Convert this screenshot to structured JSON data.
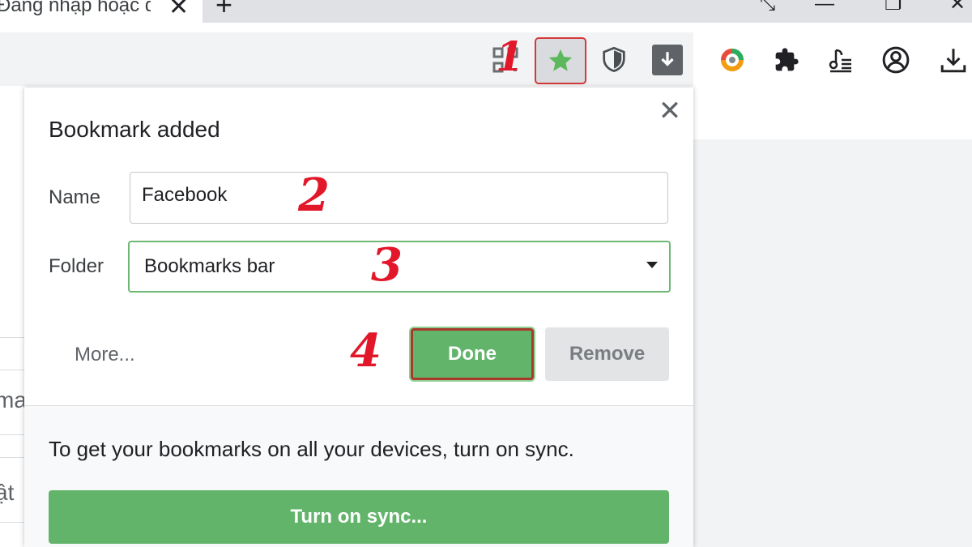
{
  "tab": {
    "title": "Đăng nhập hoặc đ",
    "close_glyph": "✕",
    "new_tab_glyph": "+"
  },
  "window": {
    "controls": [
      "⤡",
      "—",
      "❐",
      "✕"
    ]
  },
  "toolbar": {
    "icons": [
      "qr-code-icon",
      "star-icon",
      "shield-icon",
      "download-arrow-icon",
      "colorful-ring-icon",
      "puzzle-icon",
      "media-music-icon",
      "profile-icon",
      "download-icon"
    ],
    "star_color": "#5cb85c"
  },
  "annotations": {
    "n1": "1",
    "n2": "2",
    "n3": "3",
    "n4": "4",
    "color": "#e2182a"
  },
  "left_fragments": [
    "ma",
    "ật"
  ],
  "dialog": {
    "title": "Bookmark added",
    "close_glyph": "✕",
    "name_label": "Name",
    "name_value": "Facebook",
    "folder_label": "Folder",
    "folder_value": "Bookmarks bar",
    "more_label": "More...",
    "done_label": "Done",
    "remove_label": "Remove",
    "sync_message": "To get your bookmarks on all your devices, turn on sync.",
    "sync_button_label": "Turn on sync...",
    "accent": "#62b46a"
  }
}
